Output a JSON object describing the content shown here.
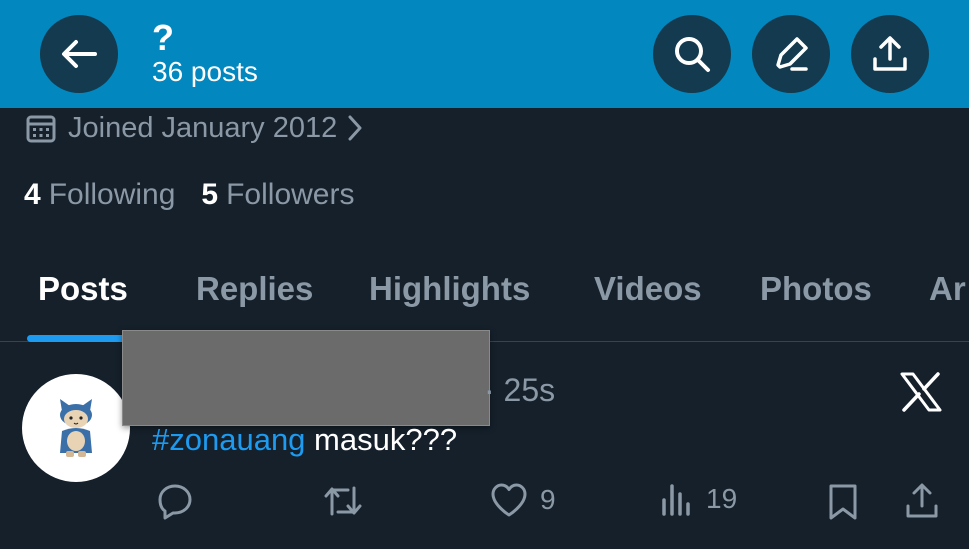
{
  "header": {
    "name": "?",
    "post_count": "36 posts",
    "background_color": "#0387bf",
    "icons": [
      "back-arrow-icon",
      "search-icon",
      "edit-icon",
      "share-icon"
    ]
  },
  "profile": {
    "joined": "Joined January 2012",
    "following_count": "4",
    "following_label": "Following",
    "followers_count": "5",
    "followers_label": "Followers"
  },
  "tabs": [
    {
      "label": "Posts",
      "active": true
    },
    {
      "label": "Replies"
    },
    {
      "label": "Highlights"
    },
    {
      "label": "Videos"
    },
    {
      "label": "Photos"
    },
    {
      "label": "Ar"
    }
  ],
  "post": {
    "time": "· 25s",
    "hashtag": "#zonauang",
    "text": " masuk???",
    "like_count": "9",
    "views_count": "19",
    "accent_color": "#1d9bf0"
  }
}
